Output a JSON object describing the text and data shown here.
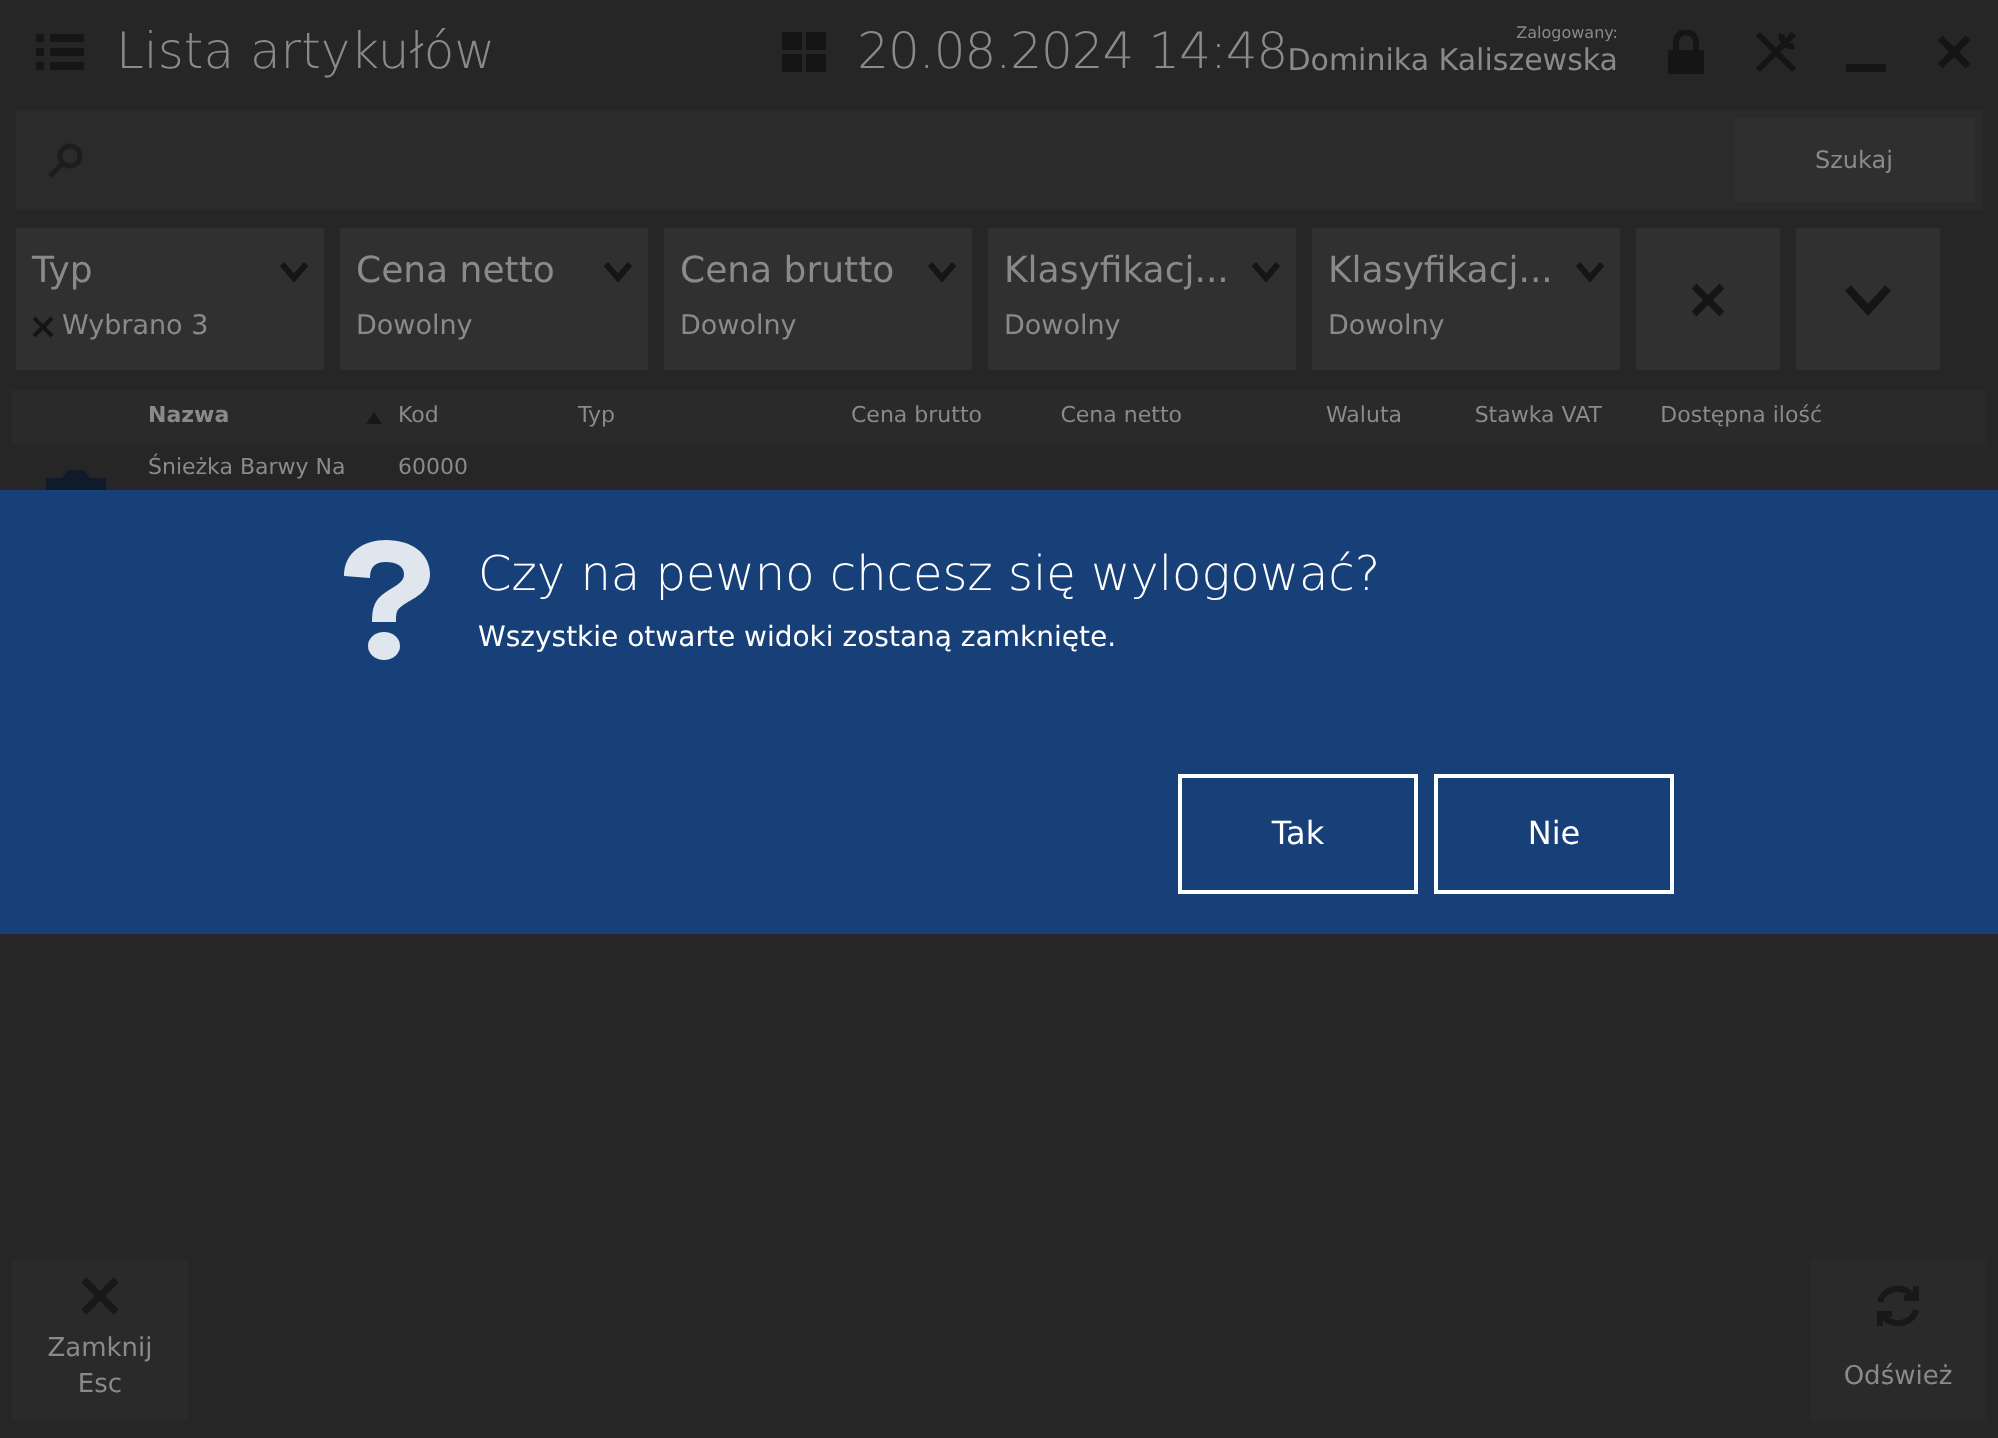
{
  "window": {
    "title": "Lista artykułów",
    "datetime": "20.08.2024 14:48",
    "user_caption": "Zalogowany:",
    "user_name": "Dominika Kaliszewska"
  },
  "search": {
    "button": "Szukaj"
  },
  "filters": [
    {
      "label": "Typ",
      "value": "Wybrano 3",
      "clearable": true
    },
    {
      "label": "Cena netto",
      "value": "Dowolny",
      "clearable": false
    },
    {
      "label": "Cena brutto",
      "value": "Dowolny",
      "clearable": false
    },
    {
      "label": "Klasyfikacj...",
      "value": "Dowolny",
      "clearable": false
    },
    {
      "label": "Klasyfikacj...",
      "value": "Dowolny",
      "clearable": false
    }
  ],
  "table": {
    "columns": [
      {
        "label": "Nazwa",
        "sorted": true
      },
      {
        "label": "Kod",
        "sorted": false
      },
      {
        "label": "Typ",
        "sorted": false
      },
      {
        "label": "Cena brutto",
        "sorted": false
      },
      {
        "label": "Cena netto",
        "sorted": false
      },
      {
        "label": "Waluta",
        "sorted": false
      },
      {
        "label": "Stawka VAT",
        "sorted": false
      },
      {
        "label": "Dostępna ilość",
        "sorted": false
      }
    ],
    "rows": [
      {
        "cells": [
          "Śnieżka Barwy Na",
          "60000"
        ]
      }
    ]
  },
  "dialog": {
    "title": "Czy na pewno chcesz się wylogować?",
    "message": "Wszystkie otwarte widoki zostaną zamknięte.",
    "buttons": [
      "Tak",
      "Nie"
    ]
  },
  "footer": {
    "close": {
      "label": "Zamknij",
      "shortcut": "Esc"
    },
    "refresh": {
      "label": "Odśwież"
    }
  }
}
